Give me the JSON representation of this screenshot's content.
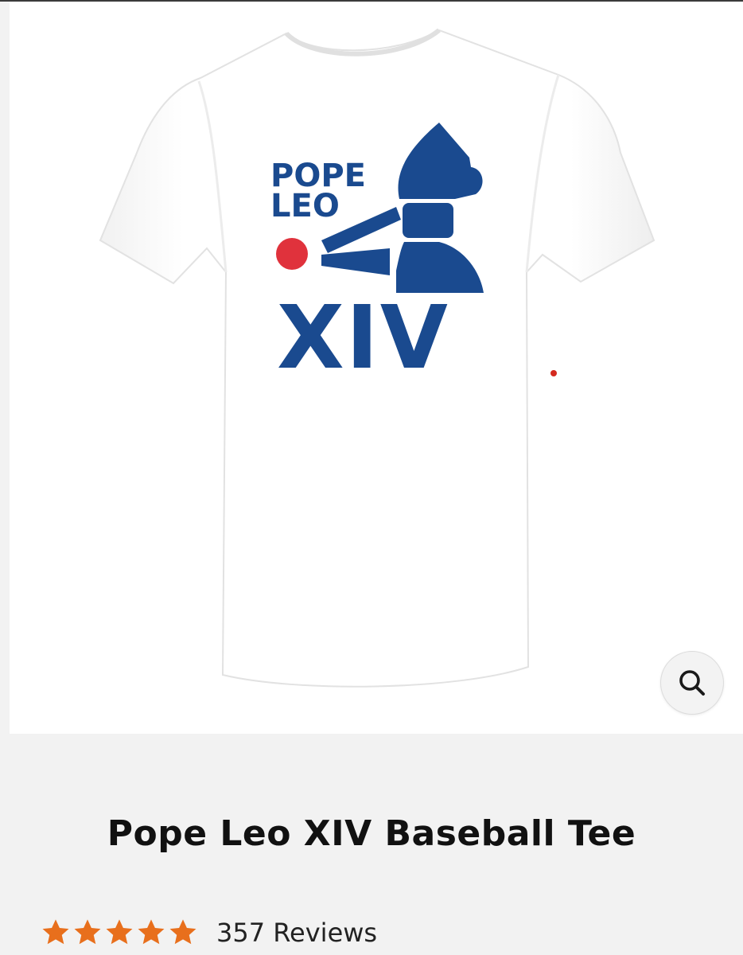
{
  "product": {
    "title": "Pope Leo XIV Baseball Tee",
    "image": {
      "logo_line1": "POPE",
      "logo_line2": "LEO",
      "logo_numeral": "XIV",
      "shirt_color": "#ffffff",
      "logo_color": "#1a4a8f",
      "ball_color": "#e0323c"
    }
  },
  "rating": {
    "stars": 5,
    "star_color": "#e86f1c",
    "reviews_label": "357 Reviews"
  },
  "controls": {
    "zoom_icon": "magnifier-icon"
  }
}
